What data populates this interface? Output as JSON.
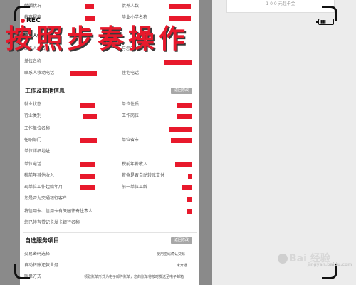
{
  "right_panel_text": "1 0 0 元起卡金",
  "overlay": {
    "rec_label": "REC",
    "headline": "按照步奏操作",
    "watermark_brand": "Bai 经验",
    "watermark_url": "jingyan.baidu.com"
  },
  "top_rows": [
    {
      "left": "婚姻状况",
      "right": "供养人数"
    },
    {
      "left": "教育程度",
      "right": "毕业小学名称"
    },
    {
      "left": "联系人信息",
      "right": ""
    },
    {
      "left": "联系人姓名",
      "right": "与您的关系"
    },
    {
      "left": "单位名称",
      "right": ""
    },
    {
      "left": "联系人移动电话",
      "right": "住宅电话"
    }
  ],
  "section_work": {
    "title": "工作及其他信息",
    "edit_label": "返回修改",
    "rows": [
      {
        "left": "就业状态",
        "right": "单位性质"
      },
      {
        "left": "行业类别",
        "right": "工作岗位"
      },
      {
        "left": "工作单位名称",
        "right": ""
      },
      {
        "left": "任职部门",
        "right": "单位省市"
      },
      {
        "left": "单位详细地址",
        "right": ""
      },
      {
        "left": "单位电话",
        "right": "税前年薪收入"
      },
      {
        "left": "税前年其他收入",
        "right": "薪金是否自动转账支付"
      },
      {
        "left": "现单位工作起始年月",
        "right": "前一单位工龄"
      },
      {
        "left": "您是否为交通银行客户",
        "right": ""
      },
      {
        "left": "将信用卡、信用卡有关函件寄往本人",
        "right": ""
      },
      {
        "left": "您已持有贷记卡发卡银行名称",
        "right": ""
      }
    ]
  },
  "section_service": {
    "title": "自选服务项目",
    "edit_label": "返回修改",
    "rows": [
      {
        "left": "交易密码选择",
        "right": "使用密码确认交易"
      },
      {
        "left": "自动转账还款业务",
        "right": "未开通"
      },
      {
        "left": "账单方式",
        "right": "领取账单形式为电子邮件账单，您的账单将按时发送至电子邮箱"
      }
    ]
  }
}
